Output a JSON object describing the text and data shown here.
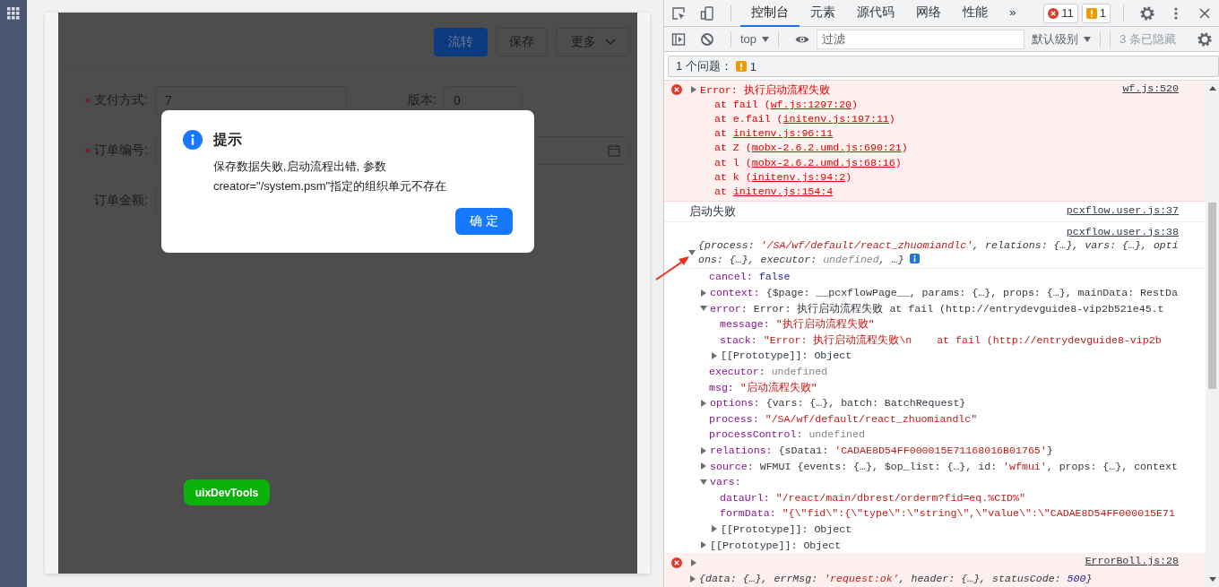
{
  "page": {
    "toolbar_buttons": [
      {
        "label": "流转",
        "kind": "primary"
      },
      {
        "label": "保存",
        "kind": "default"
      },
      {
        "label": "更多",
        "kind": "dropdown"
      }
    ],
    "form_rows": [
      [
        {
          "label": "支付方式:",
          "required": true,
          "kind": "text",
          "value": "7"
        },
        {
          "label": "版本:",
          "required": false,
          "kind": "short",
          "value": "0"
        }
      ],
      [
        {
          "label": "订单编号:",
          "required": true,
          "kind": "date"
        }
      ],
      [
        {
          "label": "订单金额:",
          "required": false,
          "kind": "text"
        }
      ]
    ],
    "floating_button": "uixDevTools"
  },
  "dialog": {
    "title": "提示",
    "message_lines": [
      "保存数据失败,启动流程出错, 参数",
      "creator=\"/system.psm\"指定的组织单元不存在"
    ],
    "ok_button": "确 定"
  },
  "devtools": {
    "tabs": [
      {
        "label": "控制台",
        "selected": true
      },
      {
        "label": "元素",
        "selected": false
      },
      {
        "label": "源代码",
        "selected": false
      },
      {
        "label": "网络",
        "selected": false
      },
      {
        "label": "性能",
        "selected": false
      }
    ],
    "more_tabs": "»",
    "error_count": "11",
    "warning_count": "1",
    "context_selector": "top",
    "filter": {
      "placeholder": "过滤"
    },
    "level_selector": "默认级别",
    "hidden_count": "3 条已隐藏",
    "issues": {
      "label": "1 个问题：",
      "count": "1"
    },
    "messages": [
      {
        "kind": "error",
        "expanded": false,
        "text": "Error: 执行启动流程失败",
        "source": "wf.js:520",
        "stack": [
          {
            "before": "at fail (",
            "link": "wf.js:1297:20",
            "after": ")"
          },
          {
            "before": "at e.fail (",
            "link": "initenv.js:197:11",
            "after": ")"
          },
          {
            "before": "at ",
            "link": "initenv.js:96:11"
          },
          {
            "before": "at Z (",
            "link": "mobx-2.6.2.umd.js:690:21",
            "after": ")"
          },
          {
            "before": "at l (",
            "link": "mobx-2.6.2.umd.js:68:16",
            "after": ")"
          },
          {
            "before": "at k (",
            "link": "initenv.js:94:2",
            "after": ")"
          },
          {
            "before": "at ",
            "link": "initenv.js:154:4"
          }
        ]
      },
      {
        "kind": "log",
        "text": "启动失败",
        "source": "pcxflow.user.js:37"
      },
      {
        "kind": "object",
        "source": "pcxflow.user.js:38",
        "expanded": true,
        "preview": [
          {
            "text": "{process: ",
            "kind": "plain"
          },
          {
            "text": "'/SA/wf/default/react_zhuomiandlc'",
            "kind": "string"
          },
          {
            "text": ", relations: {…}, vars: {…}, options: {…}, executor: ",
            "kind": "plain"
          },
          {
            "text": "undefined",
            "kind": "undefined"
          },
          {
            "text": ", …}",
            "kind": "plain"
          }
        ],
        "children": [
          {
            "kind": "property",
            "key": "cancel:",
            "value": [
              {
                "text": "false",
                "kind": "keyword"
              }
            ]
          },
          {
            "kind": "property",
            "key": "context:",
            "expanded": false,
            "value": [
              {
                "text": "{$page: __pcxflowPage__, params: {…}, props: {…}, mainData: RestDa",
                "kind": "plain"
              }
            ]
          },
          {
            "kind": "property",
            "key": "error:",
            "expanded": true,
            "value": [
              {
                "text": "Error: 执行启动流程失败 at fail (http://entrydevguide8-vip2b521e45.t",
                "kind": "plain"
              }
            ],
            "children": [
              {
                "kind": "property",
                "key": "message:",
                "value": [
                  {
                    "text": "\"执行启动流程失败\"",
                    "kind": "string"
                  }
                ]
              },
              {
                "kind": "property",
                "key": "stack:",
                "value": [
                  {
                    "text": "\"Error: 执行启动流程失败\\n    at fail (http://entrydevguide8-vip2b",
                    "kind": "string"
                  }
                ]
              },
              {
                "kind": "internal",
                "key": "[[Prototype]]:",
                "expanded": false,
                "value": [
                  {
                    "text": "Object",
                    "kind": "plain"
                  }
                ]
              }
            ]
          },
          {
            "kind": "property",
            "key": "executor:",
            "value": [
              {
                "text": "undefined",
                "kind": "undefined"
              }
            ]
          },
          {
            "kind": "property",
            "key": "msg:",
            "value": [
              {
                "text": "\"启动流程失败\"",
                "kind": "string"
              }
            ]
          },
          {
            "kind": "property",
            "key": "options:",
            "expanded": false,
            "value": [
              {
                "text": "{vars: {…}, batch: BatchRequest}",
                "kind": "plain"
              }
            ]
          },
          {
            "kind": "property",
            "key": "process:",
            "value": [
              {
                "text": "\"/SA/wf/default/react_zhuomiandlc\"",
                "kind": "string"
              }
            ]
          },
          {
            "kind": "property",
            "key": "processControl:",
            "value": [
              {
                "text": "undefined",
                "kind": "undefined"
              }
            ]
          },
          {
            "kind": "property",
            "key": "relations:",
            "expanded": false,
            "value": [
              {
                "text": "{sData1: ",
                "kind": "plain"
              },
              {
                "text": "'CADAE8D54FF000015E71168016B01765'",
                "kind": "string"
              },
              {
                "text": "}",
                "kind": "plain"
              }
            ]
          },
          {
            "kind": "property",
            "key": "source:",
            "expanded": false,
            "value": [
              {
                "text": "WFMUI {events: {…}, $op_list: {…}, id: ",
                "kind": "plain"
              },
              {
                "text": "'wfmui'",
                "kind": "string"
              },
              {
                "text": ", props: {…}, context",
                "kind": "plain"
              }
            ]
          },
          {
            "kind": "property",
            "key": "vars:",
            "expanded": true,
            "children": [
              {
                "kind": "property",
                "key": "dataUrl:",
                "value": [
                  {
                    "text": "\"/react/main/dbrest/orderm?fid=eq.%CID%\"",
                    "kind": "string"
                  }
                ]
              },
              {
                "kind": "property",
                "key": "formData:",
                "value": [
                  {
                    "text": "\"{\\\"fid\\\":{\\\"type\\\":\\\"string\\\",\\\"value\\\":\\\"CADAE8D54FF000015E71",
                    "kind": "string"
                  }
                ]
              },
              {
                "kind": "internal",
                "key": "[[Prototype]]:",
                "expanded": false,
                "value": [
                  {
                    "text": "Object",
                    "kind": "plain"
                  }
                ]
              }
            ]
          },
          {
            "kind": "internal",
            "key": "[[Prototype]]:",
            "expanded": false,
            "value": [
              {
                "text": "Object",
                "kind": "plain"
              }
            ]
          }
        ]
      },
      {
        "kind": "error_object",
        "source": "ErrorBoll.js:28",
        "expanded": false,
        "object": {
          "expanded": false,
          "preview": [
            {
              "text": "{data: {…}, errMsg: ",
              "kind": "plain"
            },
            {
              "text": "'request:ok'",
              "kind": "string"
            },
            {
              "text": ", header: {…}, statusCode: ",
              "kind": "plain"
            },
            {
              "text": "500",
              "kind": "number"
            },
            {
              "text": "}",
              "kind": "plain"
            }
          ]
        }
      }
    ]
  }
}
